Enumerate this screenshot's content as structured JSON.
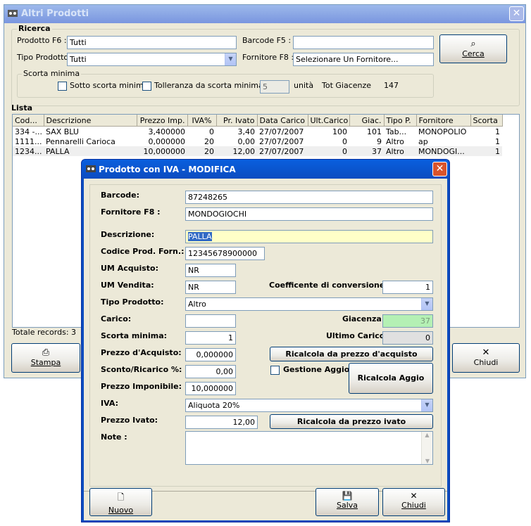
{
  "main": {
    "title": "Altri Prodotti",
    "close": "✕",
    "search_group": "Ricerca",
    "prodotto_label": "Prodotto F6 :",
    "prodotto_value": "Tutti",
    "barcode_label": "Barcode F5 :",
    "barcode_value": "",
    "tipo_label": "Tipo Prodotto:",
    "tipo_value": "Tutti",
    "fornitore_label": "Fornitore F8 :",
    "fornitore_value": "Selezionare Un Fornitore...",
    "cerca_label": "Cerca",
    "scorta_group": "Scorta minima",
    "sotto_label": "Sotto scorta minima",
    "tolleranza_label": "Tolleranza da scorta minima di",
    "tolleranza_value": "5",
    "unita_label": "unità",
    "tot_giacenze_label": "Tot Giacenze",
    "tot_giacenze_value": "147",
    "lista_label": "Lista",
    "columns": [
      "Cod...",
      "Descrizione",
      "Prezzo Imp.",
      "IVA%",
      "Pr. Ivato",
      "Data Carico",
      "Ult.Carico",
      "Giac.",
      "Tipo P.",
      "Fornitore",
      "Scorta"
    ],
    "rows": [
      [
        "334 -...",
        "SAX BLU",
        "3,400000",
        "0",
        "3,40",
        "27/07/2007",
        "100",
        "101",
        "Tab...",
        "MONOPOLIO",
        "1"
      ],
      [
        "1111...",
        "Pennarelli Carioca",
        "0,000000",
        "20",
        "0,00",
        "27/07/2007",
        "0",
        "9",
        "Altro",
        "ap",
        "1"
      ],
      [
        "1234...",
        "PALLA",
        "10,000000",
        "20",
        "12,00",
        "27/07/2007",
        "0",
        "37",
        "Altro",
        "MONDOGI...",
        "1"
      ]
    ],
    "totale_records": "Totale records: 3",
    "stampa_label": "Stampa",
    "chiudi_label": "Chiudi"
  },
  "dialog": {
    "title": "Prodotto con IVA - MODIFICA",
    "close": "✕",
    "barcode_label": "Barcode:",
    "barcode_value": "87248265",
    "fornitore_label": "Fornitore F8 :",
    "fornitore_value": "MONDOGIOCHI",
    "descrizione_label": "Descrizione:",
    "descrizione_value": "PALLA",
    "codice_label": "Codice Prod. Forn.:",
    "codice_value": "12345678900000",
    "um_acquisto_label": "UM Acquisto:",
    "um_acquisto_value": "NR",
    "um_vendita_label": "UM Vendita:",
    "um_vendita_value": "NR",
    "coeff_label": "Coefficente di conversione:",
    "coeff_value": "1",
    "tipo_label": "Tipo Prodotto:",
    "tipo_value": "Altro",
    "carico_label": "Carico:",
    "carico_value": "",
    "giacenza_label": "Giacenza:",
    "giacenza_value": "37",
    "scorta_label": "Scorta minima:",
    "scorta_value": "1",
    "ultimo_label": "Ultimo Carico:",
    "ultimo_value": "0",
    "prezzo_acq_label": "Prezzo d'Acquisto:",
    "prezzo_acq_value": "0,000000",
    "ricalcola_acq_label": "Ricalcola da prezzo d'acquisto",
    "sconto_label": "Sconto/Ricarico %:",
    "sconto_value": "0,00",
    "gestione_aggio_label": "Gestione Aggio",
    "ricalcola_aggio_label": "Ricalcola Aggio",
    "prezzo_imp_label": "Prezzo Imponibile:",
    "prezzo_imp_value": "10,000000",
    "iva_label": "IVA:",
    "iva_value": "Aliquota 20%",
    "prezzo_ivato_label": "Prezzo Ivato:",
    "prezzo_ivato_value": "12,00",
    "ricalcola_ivato_label": "Ricalcola da prezzo ivato",
    "note_label": "Note :",
    "note_value": "",
    "nuovo_label": "Nuovo",
    "salva_label": "Salva",
    "chiudi_label": "Chiudi"
  }
}
